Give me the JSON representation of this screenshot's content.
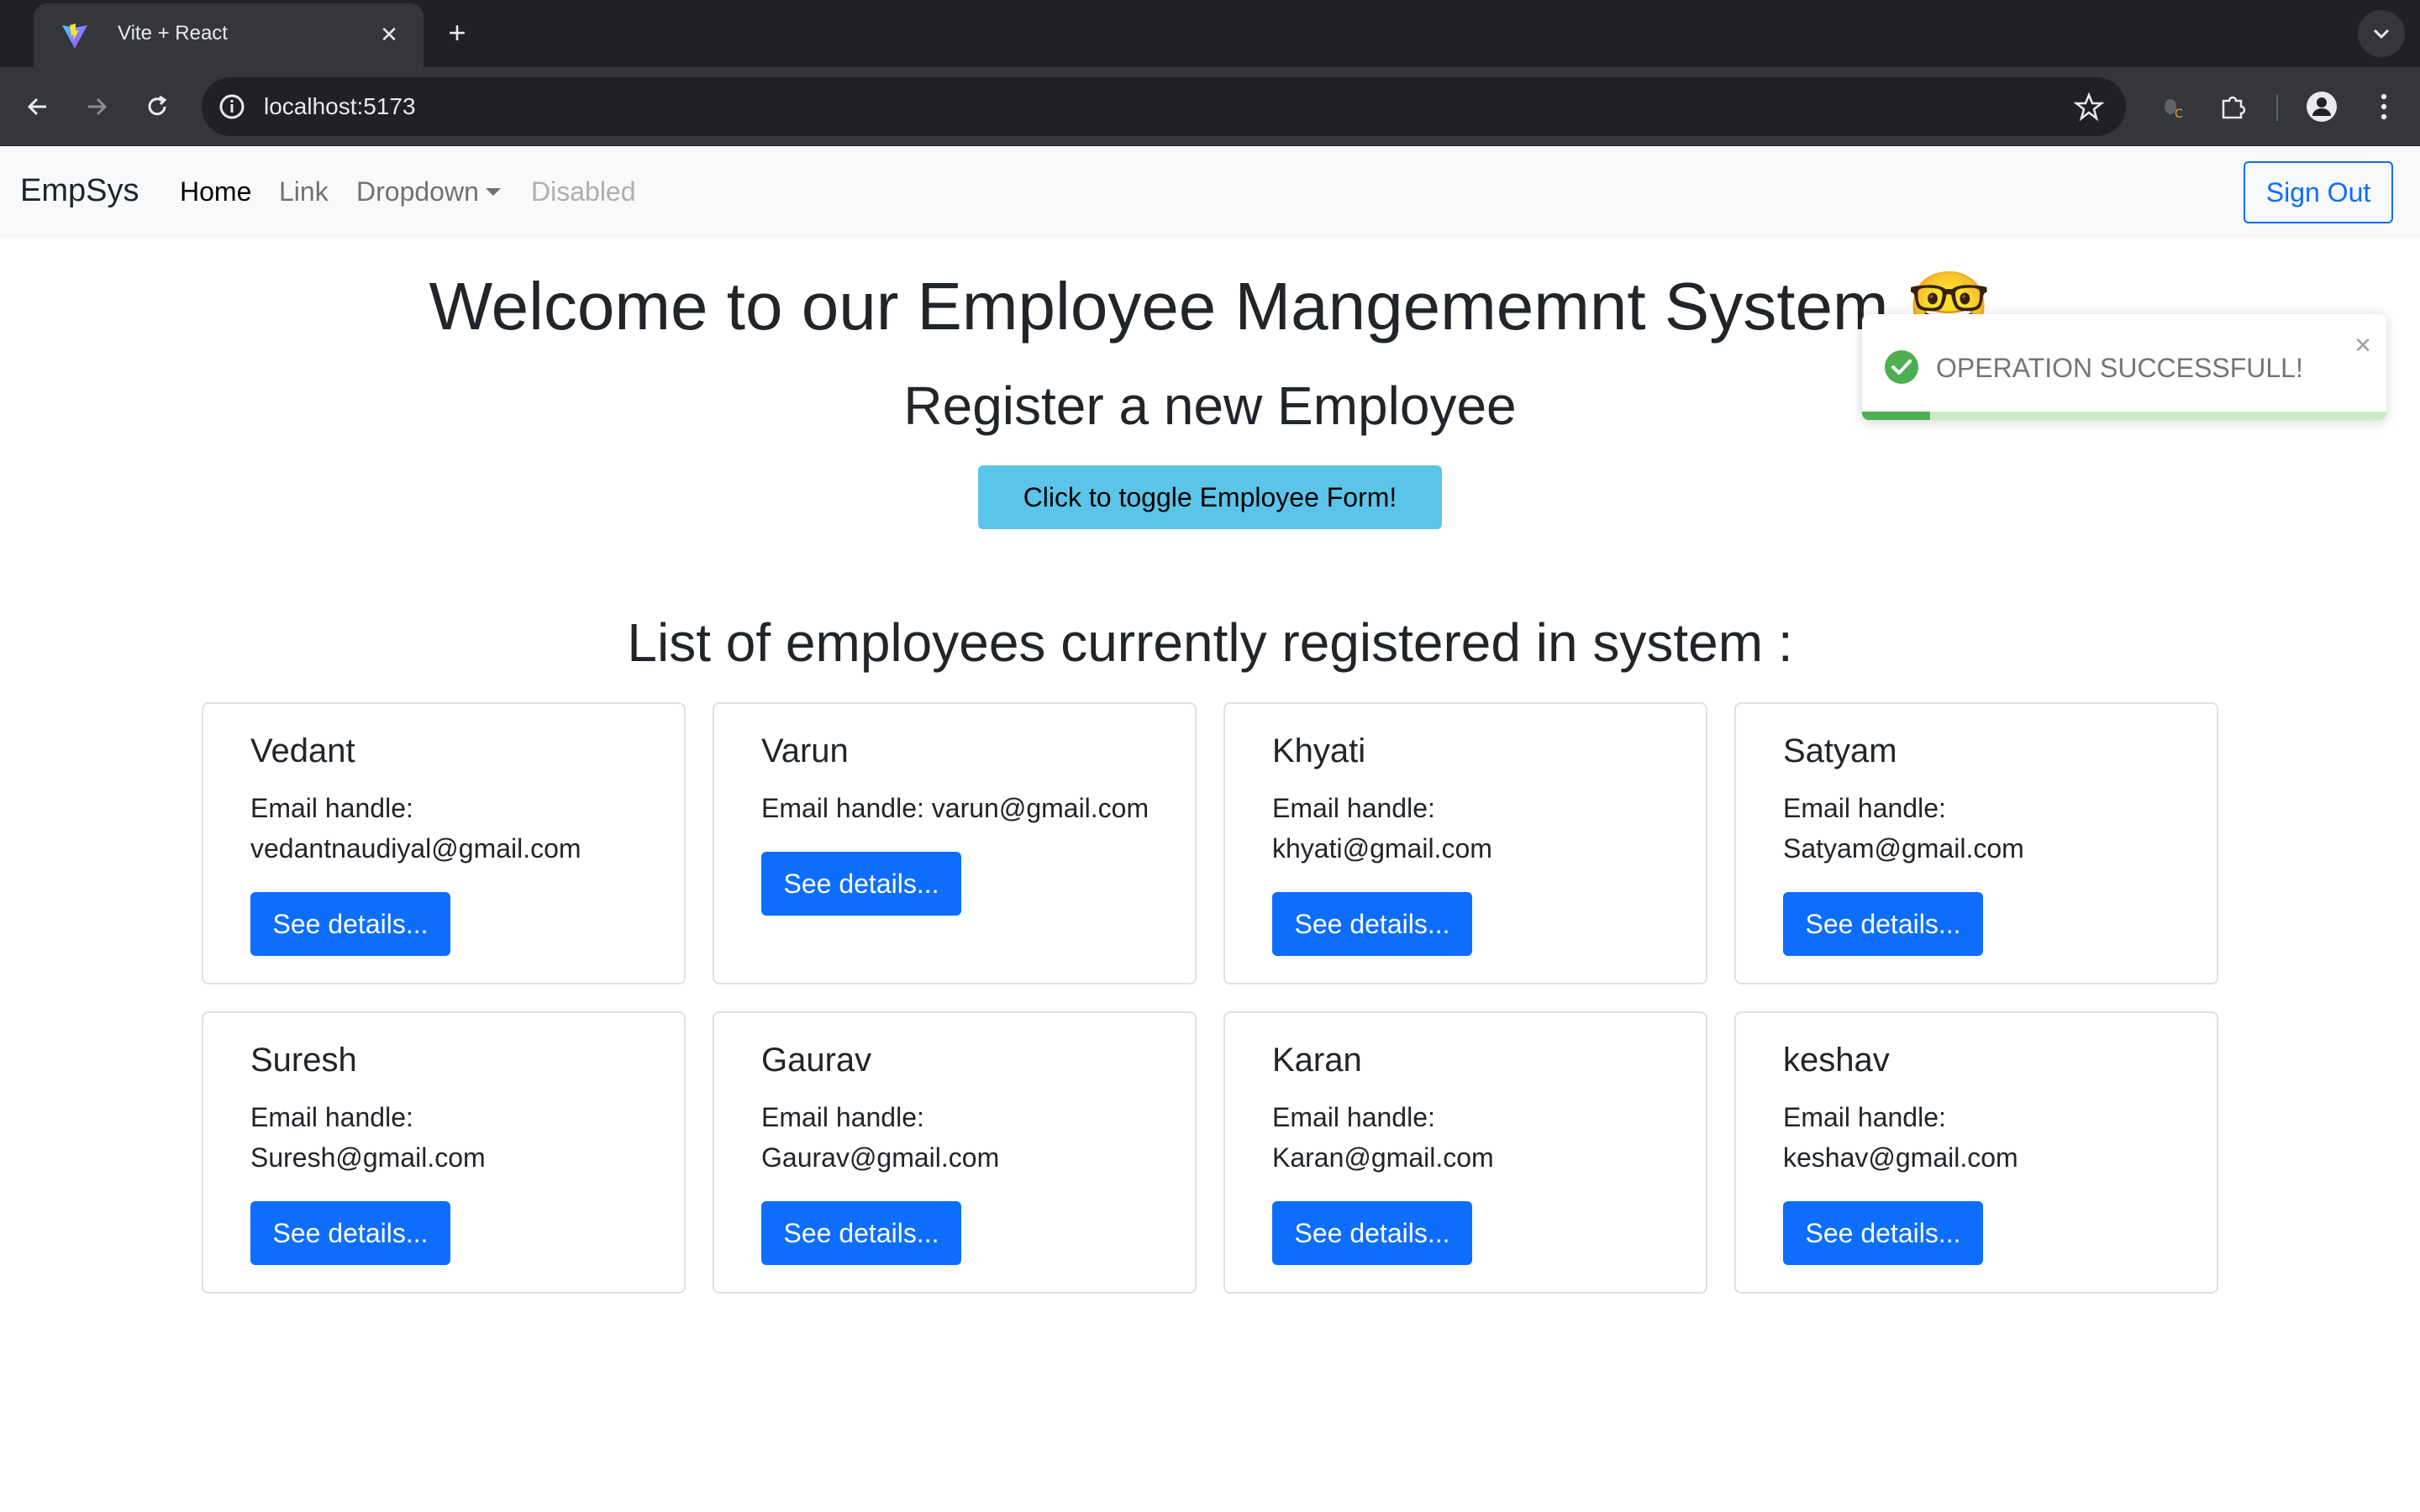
{
  "browser": {
    "tab_title": "Vite + React",
    "url": "localhost:5173",
    "icons": [
      "vite-favicon",
      "back-arrow-icon",
      "forward-arrow-icon",
      "reload-icon",
      "site-info-icon",
      "star-icon",
      "extension-bug-icon",
      "extensions-puzzle-icon",
      "profile-icon",
      "more-menu-icon"
    ]
  },
  "navbar": {
    "brand": "EmpSys",
    "links": [
      "Home",
      "Link",
      "Dropdown",
      "Disabled"
    ],
    "sign_out": "Sign Out"
  },
  "main": {
    "title": "Welcome to our Employee Mangememnt System",
    "title_emoji": "🤓",
    "register_heading": "Register a new Employee",
    "toggle_button": "Click to toggle Employee Form!",
    "list_heading": "List of employees currently registered in system :"
  },
  "employees": [
    {
      "name": "Vedant",
      "email_label": "Email handle:",
      "email": "vedantnaudiyal@gmail.com",
      "button": "See details..."
    },
    {
      "name": "Varun",
      "email_label": "Email handle:",
      "email": "varun@gmail.com",
      "button": "See details..."
    },
    {
      "name": "Khyati",
      "email_label": "Email handle:",
      "email": "khyati@gmail.com",
      "button": "See details..."
    },
    {
      "name": "Satyam",
      "email_label": "Email handle:",
      "email": "Satyam@gmail.com",
      "button": "See details..."
    },
    {
      "name": "Suresh",
      "email_label": "Email handle:",
      "email": "Suresh@gmail.com",
      "button": "See details..."
    },
    {
      "name": "Gaurav",
      "email_label": "Email handle:",
      "email": "Gaurav@gmail.com",
      "button": "See details..."
    },
    {
      "name": "Karan",
      "email_label": "Email handle:",
      "email": "Karan@gmail.com",
      "button": "See details..."
    },
    {
      "name": "keshav",
      "email_label": "Email handle:",
      "email": "keshav@gmail.com",
      "button": "See details..."
    }
  ],
  "toast": {
    "message": "OPERATION SUCCESSFULL!",
    "close": "×",
    "progress_fraction": 0.13,
    "success_color": "#4caf50"
  },
  "colors": {
    "primary": "#0d6efd",
    "info": "#5bc4e9",
    "navbar_bg": "#f8f9fa"
  }
}
